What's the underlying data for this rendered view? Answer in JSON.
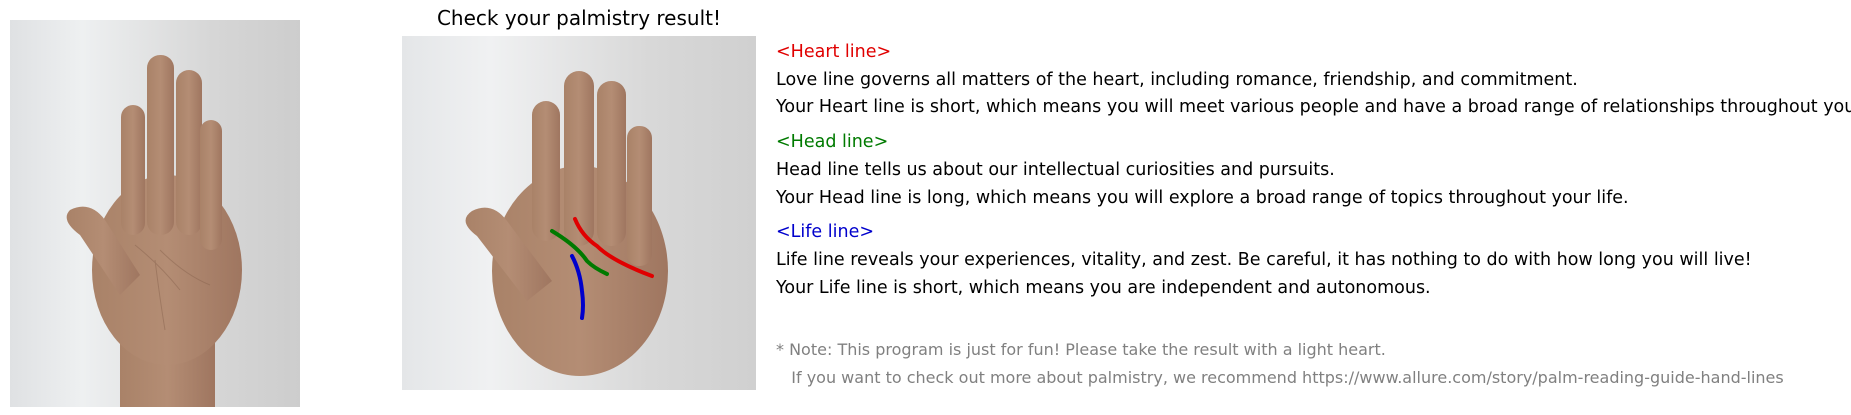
{
  "header": {
    "title": "Check your palmistry result!"
  },
  "images": {
    "input_hand": {
      "icon": "hand-photo-icon"
    },
    "result_hand": {
      "icon": "hand-photo-with-lines-icon"
    }
  },
  "colors": {
    "heart": "#e00000",
    "head": "#007a00",
    "life": "#0000cc",
    "note": "#808080"
  },
  "sections": {
    "heart": {
      "heading": "<Heart line>",
      "description": "Love line governs all matters of the heart, including romance, friendship, and commitment.",
      "result": "Your Heart line is short, which means you will meet various people and have a broad range of relationships throughout your life."
    },
    "head": {
      "heading": "<Head line>",
      "description": "Head line tells us about our intellectual curiosities and pursuits.",
      "result": "Your Head line is long, which means you will explore a broad range of topics throughout your life."
    },
    "life": {
      "heading": "<Life line>",
      "description": "Life line reveals your experiences, vitality, and zest. Be careful, it has nothing to do with how long you will live!",
      "result": "Your Life line is short, which means you are independent and autonomous."
    }
  },
  "note": {
    "line1": "* Note: This program is just for fun! Please take the result with a light heart.",
    "line2": "   If you want to check out more about palmistry, we recommend https://www.allure.com/story/palm-reading-guide-hand-lines"
  }
}
